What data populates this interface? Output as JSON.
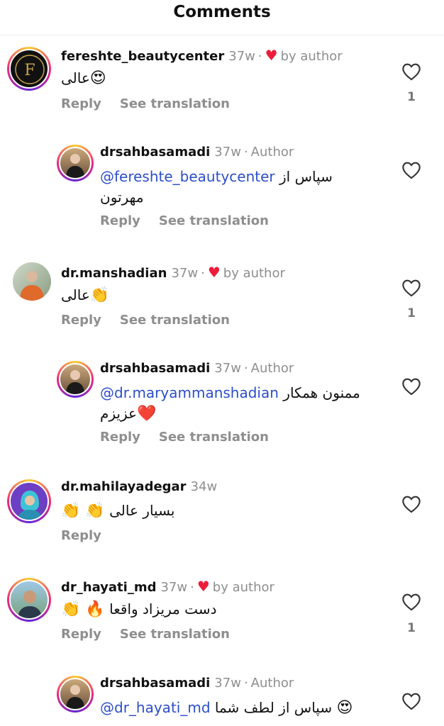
{
  "header": {
    "title": "Comments"
  },
  "icons": {
    "heart_liked": "heart-filled-red",
    "heart_outline": "heart-outline"
  },
  "comments": [
    {
      "username": "fereshte_beautycenter",
      "time": "37w",
      "liked_by_author": "by author",
      "text": "عالی",
      "emoji": "😍",
      "reply_label": "Reply",
      "translate_label": "See translation",
      "like_count": "1"
    },
    {
      "username": "drsahbasamadi",
      "time": "37w",
      "author_label": "Author",
      "mention": "@fereshte_beautycenter",
      "text_line1": "سپاس از",
      "text_line2": "مهرتون",
      "reply_label": "Reply",
      "translate_label": "See translation"
    },
    {
      "username": "dr.manshadian",
      "time": "37w",
      "liked_by_author": "by author",
      "text": "عالی",
      "emoji": "👏",
      "reply_label": "Reply",
      "translate_label": "See translation",
      "like_count": "1"
    },
    {
      "username": "drsahbasamadi",
      "time": "37w",
      "author_label": "Author",
      "mention": "@dr.maryammanshadian",
      "text_line1": "ممنون همکار",
      "text_line2": "عزیزم",
      "emoji": "❤️",
      "reply_label": "Reply",
      "translate_label": "See translation"
    },
    {
      "username": "dr.mahilayadegar",
      "time": "34w",
      "text": "بسیار عالی",
      "emoji": "👏 👏",
      "reply_label": "Reply"
    },
    {
      "username": "dr_hayati_md",
      "time": "37w",
      "liked_by_author": "by author",
      "text": "دست مریزاد واقعا",
      "emoji": "👏 🔥",
      "reply_label": "Reply",
      "translate_label": "See translation",
      "like_count": "1"
    },
    {
      "username": "drsahbasamadi",
      "time": "37w",
      "author_label": "Author",
      "mention": "@dr_hayati_md",
      "text_line1": "سپاس از لطف شما",
      "emoji": "😍"
    }
  ]
}
